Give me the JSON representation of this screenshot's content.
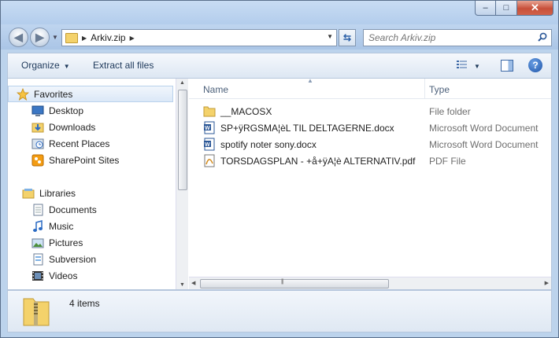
{
  "window": {
    "minimize_glyph": "–",
    "maximize_glyph": "□",
    "close_glyph": "✕"
  },
  "navigation": {
    "back_glyph": "◀",
    "forward_glyph": "▶",
    "refresh_glyph": "⇆",
    "breadcrumb": [
      "Arkiv.zip"
    ],
    "search_placeholder": "Search Arkiv.zip"
  },
  "toolbar": {
    "organize_label": "Organize",
    "extract_label": "Extract all files",
    "help_glyph": "?"
  },
  "nav_pane": {
    "favorites": {
      "label": "Favorites",
      "items": [
        {
          "label": "Desktop",
          "icon": "desktop-icon"
        },
        {
          "label": "Downloads",
          "icon": "downloads-icon"
        },
        {
          "label": "Recent Places",
          "icon": "recent-places-icon"
        },
        {
          "label": "SharePoint Sites",
          "icon": "sharepoint-icon"
        }
      ]
    },
    "libraries": {
      "label": "Libraries",
      "items": [
        {
          "label": "Documents",
          "icon": "documents-icon"
        },
        {
          "label": "Music",
          "icon": "music-icon"
        },
        {
          "label": "Pictures",
          "icon": "pictures-icon"
        },
        {
          "label": "Subversion",
          "icon": "subversion-icon"
        },
        {
          "label": "Videos",
          "icon": "videos-icon"
        }
      ]
    }
  },
  "file_list": {
    "columns": {
      "name": "Name",
      "type": "Type"
    },
    "rows": [
      {
        "name": "__MACOSX",
        "type": "File folder",
        "icon": "folder-icon"
      },
      {
        "name": "SP+ÿRGSMA¦èL TIL DELTAGERNE.docx",
        "type": "Microsoft Word Document",
        "icon": "word-doc-icon"
      },
      {
        "name": "spotify noter sony.docx",
        "type": "Microsoft Word Document",
        "icon": "word-doc-icon"
      },
      {
        "name": "TORSDAGSPLAN - +å+ÿA¦è ALTERNATIV.pdf",
        "type": "PDF File",
        "icon": "pdf-icon"
      }
    ]
  },
  "details": {
    "item_count": "4 items"
  },
  "colors": {
    "chrome": "#bcd3ec",
    "selection": "#dbe8f7",
    "link_text": "#1e395b"
  }
}
